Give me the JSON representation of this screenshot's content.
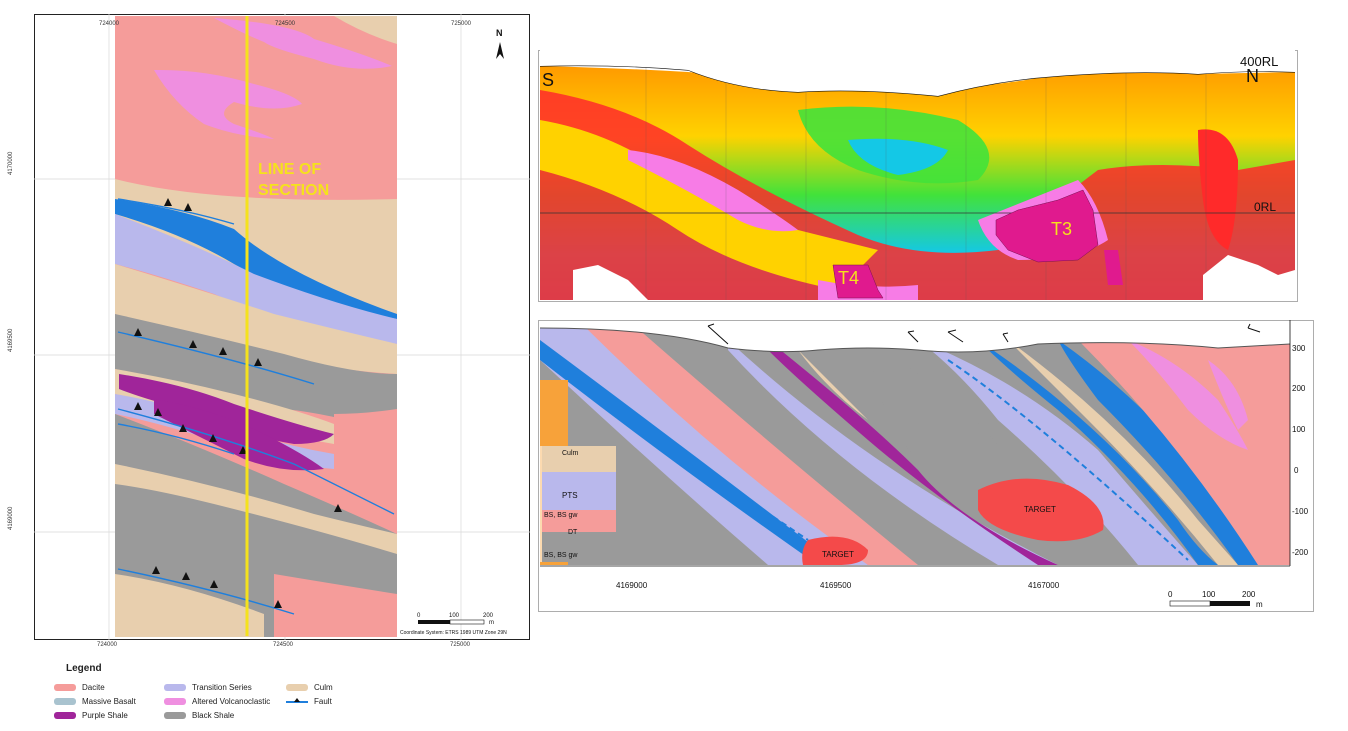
{
  "map": {
    "top_x_ticks": [
      "724000",
      "724500",
      "725000"
    ],
    "bottom_x_ticks": [
      "724000",
      "724500",
      "725000"
    ],
    "y_ticks": [
      "4170000",
      "4169500",
      "4169000"
    ],
    "north_label": "N",
    "line_of_section_label": [
      "LINE OF",
      "SECTION"
    ],
    "scale_ticks": [
      "0",
      "100",
      "200"
    ],
    "scale_unit": "m",
    "coordinate_system": "Coordinate System: ETRS 1989 UTM Zone 29N"
  },
  "geophysics": {
    "left_label": "S",
    "right_label": "N",
    "top_rl": "400RL",
    "zero_rl": "0RL",
    "targets": [
      "T3",
      "T4"
    ]
  },
  "section": {
    "x_ticks": [
      "4169000",
      "4169500",
      "4167000"
    ],
    "y_ticks": [
      "300",
      "200",
      "100",
      "0",
      "-100",
      "-200"
    ],
    "target_labels": [
      "TARGET",
      "TARGET"
    ],
    "inset_labels": [
      "Culm",
      "PTS",
      "BS, BS gw",
      "DT",
      "BS, BS gw"
    ],
    "scale_ticks": [
      "0",
      "100",
      "200"
    ],
    "scale_unit": "m"
  },
  "legend": {
    "title": "Legend",
    "items": [
      {
        "label": "Dacite",
        "color": "#f59c9a"
      },
      {
        "label": "Massive Basalt",
        "color": "#a9c3cf"
      },
      {
        "label": "Purple Shale",
        "color": "#a0259a"
      },
      {
        "label": "Transition Series",
        "color": "#b9b8ec"
      },
      {
        "label": "Altered Volcanoclastic",
        "color": "#ef8fe0"
      },
      {
        "label": "Black Shale",
        "color": "#9a9a9a"
      },
      {
        "label": "Culm",
        "color": "#e8cfae"
      },
      {
        "label": "Fault",
        "color": "#1f7fdc"
      }
    ]
  },
  "colors": {
    "dacite": "#f59c9a",
    "culm": "#e8cfae",
    "transition": "#b9b8ec",
    "black_shale": "#9a9a9a",
    "purple_shale": "#a0259a",
    "fault": "#1f7fdc",
    "altered": "#ef8fe0",
    "section_line": "#f5e21c"
  }
}
